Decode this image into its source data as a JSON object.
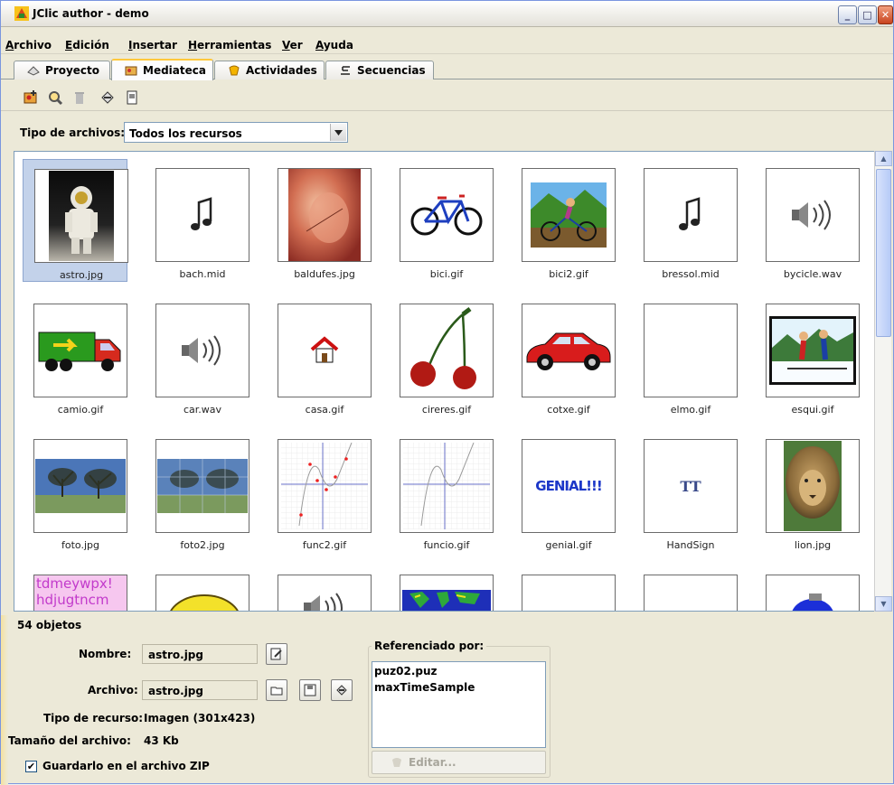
{
  "window": {
    "title": "JClic author - demo"
  },
  "menubar": {
    "items": [
      {
        "label": "Archivo",
        "u": "A",
        "rest": "rchivo"
      },
      {
        "label": "Edición",
        "u": "E",
        "rest": "dición"
      },
      {
        "label": "Insertar",
        "u": "I",
        "rest": "nsertar"
      },
      {
        "label": "Herramientas",
        "u": "H",
        "rest": "erramientas"
      },
      {
        "label": "Ver",
        "u": "V",
        "rest": "er"
      },
      {
        "label": "Ayuda",
        "u": "A",
        "rest": "yuda"
      }
    ]
  },
  "tabs": [
    {
      "label": "Proyecto",
      "icon": "project-icon",
      "active": false
    },
    {
      "label": "Mediateca",
      "icon": "media-library-icon",
      "active": true
    },
    {
      "label": "Actividades",
      "icon": "activities-icon",
      "active": false
    },
    {
      "label": "Secuencias",
      "icon": "sequences-icon",
      "active": false
    }
  ],
  "toolbar": {
    "tools": [
      "add-media-icon",
      "preview-icon",
      "delete-icon",
      "update-icon",
      "export-icon"
    ]
  },
  "filter": {
    "label": "Tipo de archivos:",
    "selected": "Todos los recursos"
  },
  "media": {
    "items": [
      {
        "name": "astro.jpg",
        "kind": "photo-astronaut",
        "selected": true
      },
      {
        "name": "bach.mid",
        "kind": "music-note"
      },
      {
        "name": "baldufes.jpg",
        "kind": "photo-tops"
      },
      {
        "name": "bici.gif",
        "kind": "bicycle"
      },
      {
        "name": "bici2.gif",
        "kind": "cyclist"
      },
      {
        "name": "bressol.mid",
        "kind": "music-note"
      },
      {
        "name": "bycicle.wav",
        "kind": "speaker"
      },
      {
        "name": "camio.gif",
        "kind": "truck"
      },
      {
        "name": "car.wav",
        "kind": "speaker"
      },
      {
        "name": "casa.gif",
        "kind": "house"
      },
      {
        "name": "cireres.gif",
        "kind": "cherries"
      },
      {
        "name": "cotxe.gif",
        "kind": "car"
      },
      {
        "name": "elmo.gif",
        "kind": "blank"
      },
      {
        "name": "esqui.gif",
        "kind": "skiers"
      },
      {
        "name": "foto.jpg",
        "kind": "photo-trees"
      },
      {
        "name": "foto2.jpg",
        "kind": "photo-trees-puzzle"
      },
      {
        "name": "func2.gif",
        "kind": "function-plot-points"
      },
      {
        "name": "funcio.gif",
        "kind": "function-plot"
      },
      {
        "name": "genial.gif",
        "kind": "genial-text"
      },
      {
        "name": "HandSign",
        "kind": "font-icon"
      },
      {
        "name": "lion.jpg",
        "kind": "photo-lion"
      },
      {
        "name": "",
        "kind": "letters"
      },
      {
        "name": "",
        "kind": "lemon"
      },
      {
        "name": "",
        "kind": "speaker"
      },
      {
        "name": "",
        "kind": "world-map"
      },
      {
        "name": "",
        "kind": "blank"
      },
      {
        "name": "",
        "kind": "blank"
      },
      {
        "name": "",
        "kind": "blue-object"
      }
    ],
    "genial_text": "GENIAL!!!",
    "font_icon_text": "TT",
    "letters_text_1": "tdmeywpx!",
    "letters_text_2": "hdjugtncm"
  },
  "details": {
    "count": "54 objetos",
    "name_label": "Nombre:",
    "name_value": "astro.jpg",
    "file_label": "Archivo:",
    "file_value": "astro.jpg",
    "type_label": "Tipo de recurso:",
    "type_value": "Imagen (301x423)",
    "size_label": "Tamaño del archivo:",
    "size_value": "43 Kb",
    "zip_label": "Guardarlo en el archivo ZIP",
    "zip_checked": true
  },
  "references": {
    "title": "Referenciado por:",
    "items": [
      "puz02.puz",
      "maxTimeSample"
    ],
    "edit_label": "Editar..."
  }
}
